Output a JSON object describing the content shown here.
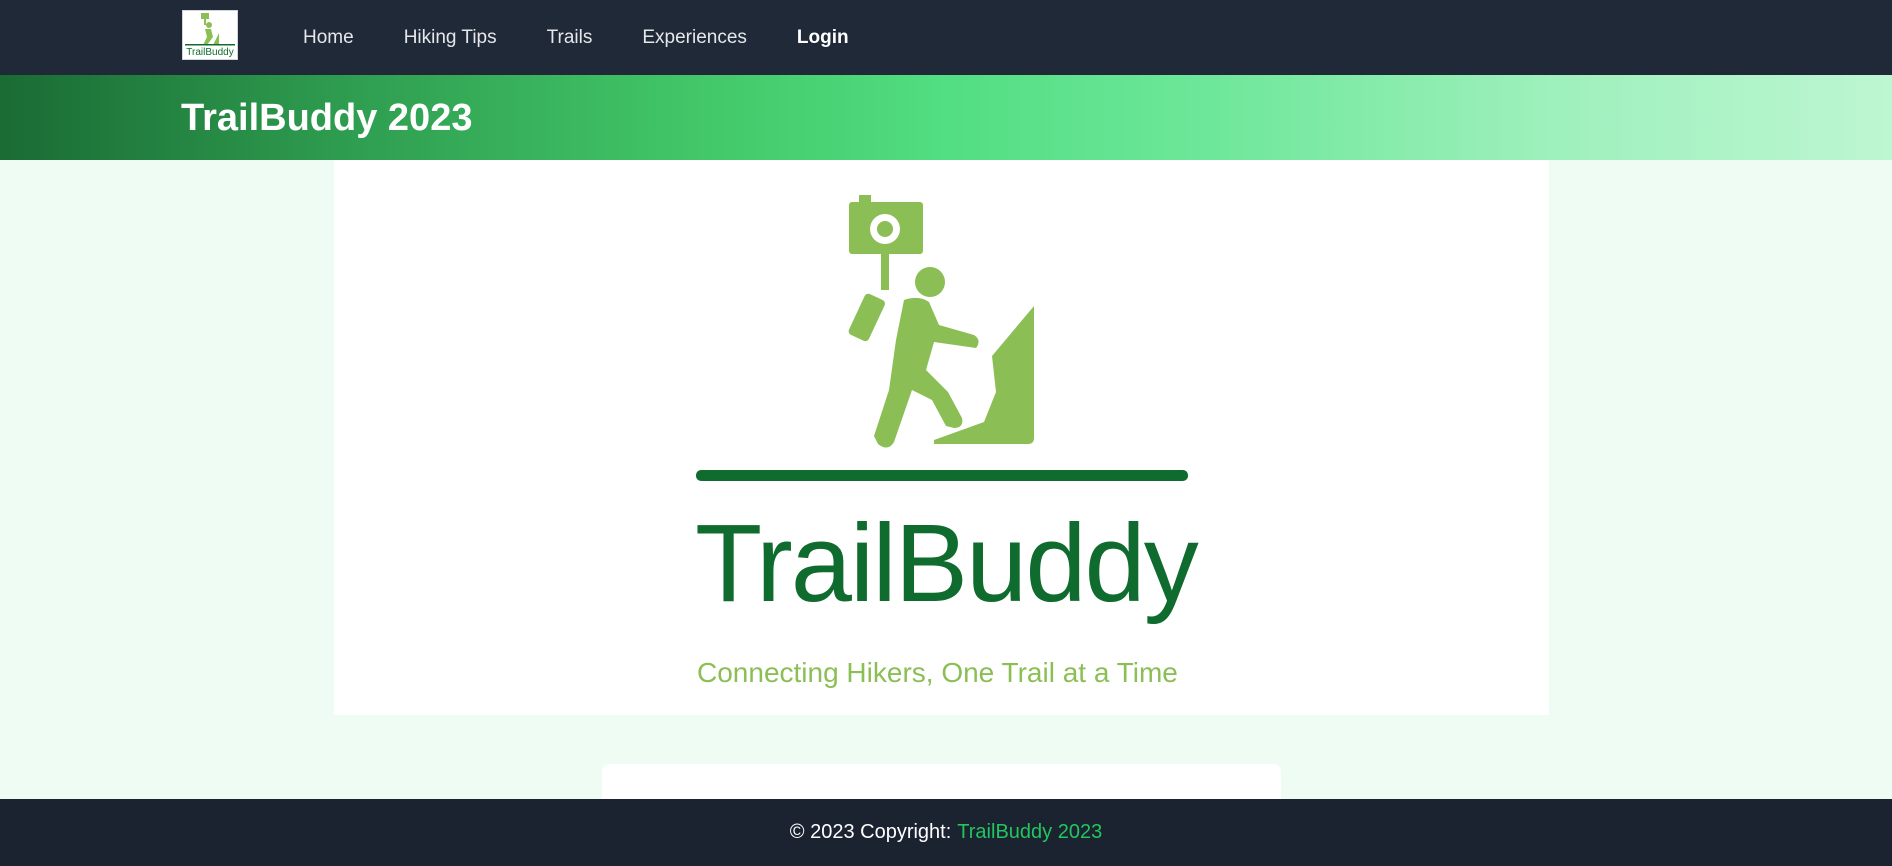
{
  "nav": {
    "logo_text": "TrailBuddy",
    "items": [
      {
        "label": "Home"
      },
      {
        "label": "Hiking Tips"
      },
      {
        "label": "Trails"
      },
      {
        "label": "Experiences"
      },
      {
        "label": "Login"
      }
    ]
  },
  "banner": {
    "title": "TrailBuddy 2023"
  },
  "hero": {
    "brand": "TrailBuddy",
    "tagline": "Connecting Hikers, One Trail at a Time"
  },
  "footer": {
    "prefix": "© 2023 Copyright:",
    "link": "TrailBuddy 2023"
  },
  "colors": {
    "nav_bg": "#1f2937",
    "accent_green": "#22c55e",
    "dark_green": "#0f6b2e",
    "light_green": "#8bbf55"
  }
}
